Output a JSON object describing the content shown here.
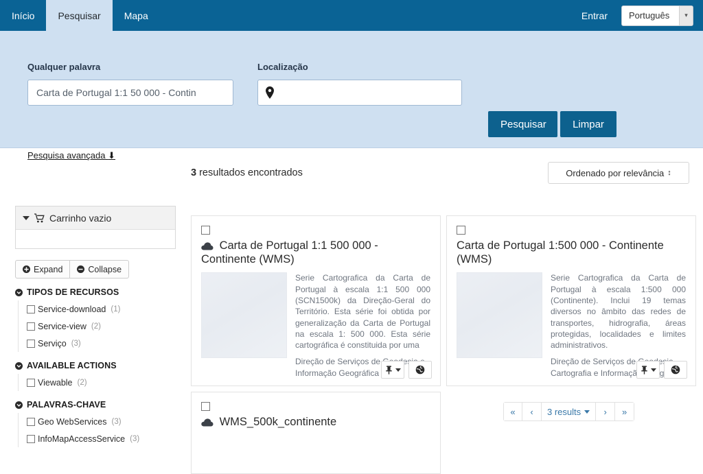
{
  "nav": {
    "tabs": [
      {
        "label": "Início",
        "active": false
      },
      {
        "label": "Pesquisar",
        "active": true
      },
      {
        "label": "Mapa",
        "active": false
      }
    ],
    "login_label": "Entrar",
    "language_value": "Português"
  },
  "search": {
    "keyword_label": "Qualquer palavra",
    "keyword_value": "Carta de Portugal 1:1 50 000 - Contin",
    "location_label": "Localização",
    "location_value": "",
    "location_placeholder": "",
    "search_button": "Pesquisar",
    "clear_button": "Limpar",
    "advanced_link": "Pesquisa avançada"
  },
  "sidebar": {
    "cart_label": "Carrinho vazio",
    "expand_label": "Expand",
    "collapse_label": "Collapse",
    "facets": [
      {
        "title": "TIPOS DE RECURSOS",
        "items": [
          {
            "label": "Service-download",
            "count": "(1)"
          },
          {
            "label": "Service-view",
            "count": "(2)"
          },
          {
            "label": "Serviço",
            "count": "(3)"
          }
        ]
      },
      {
        "title": "AVAILABLE ACTIONS",
        "items": [
          {
            "label": "Viewable",
            "count": "(2)"
          }
        ]
      },
      {
        "title": "PALAVRAS-CHAVE",
        "items": [
          {
            "label": "Geo WebServices",
            "count": "(3)"
          },
          {
            "label": "InfoMapAccessService",
            "count": "(3)"
          }
        ]
      }
    ]
  },
  "results": {
    "count_number": "3",
    "count_text": " resultados encontrados",
    "sort_label": "Ordenado por relevância",
    "cards": [
      {
        "title": "Carta de Portugal 1:1 500 000 - Continente (WMS)",
        "has_cloud_icon": true,
        "abstract": "Serie Cartografica da Carta de Portugal à escala 1:1 500 000 (SCN1500k) da Direção-Geral do Território. Esta série foi obtida por generalização da Carta de Portugal na escala 1: 500 000. Esta série cartográfica é constituida por uma",
        "organisation": "Direção de Serviços de Geodesia e Informação Geográfica"
      },
      {
        "title": "Carta de Portugal 1:500 000 - Continente (WMS)",
        "has_cloud_icon": false,
        "abstract": "Serie Cartografica da Carta de Portugal à escala 1:500 000 (Continente). Inclui 19 temas diversos no âmbito das redes de transportes, hidrografia, áreas protegidas, localidades e limites administrativos.",
        "organisation": "Direção de Serviços de Geodesia, Cartografia e Informação Geográfica"
      },
      {
        "title": "WMS_500k_continente",
        "has_cloud_icon": true,
        "abstract": "",
        "organisation": ""
      }
    ]
  },
  "pagination": {
    "first": "«",
    "prev": "‹",
    "current": "3 results",
    "next": "›",
    "last": "»"
  },
  "colors": {
    "header_blue": "#0a6395",
    "panel_blue": "#cfe0f1",
    "button_blue": "#0d618e",
    "link_blue": "#3978a8"
  }
}
